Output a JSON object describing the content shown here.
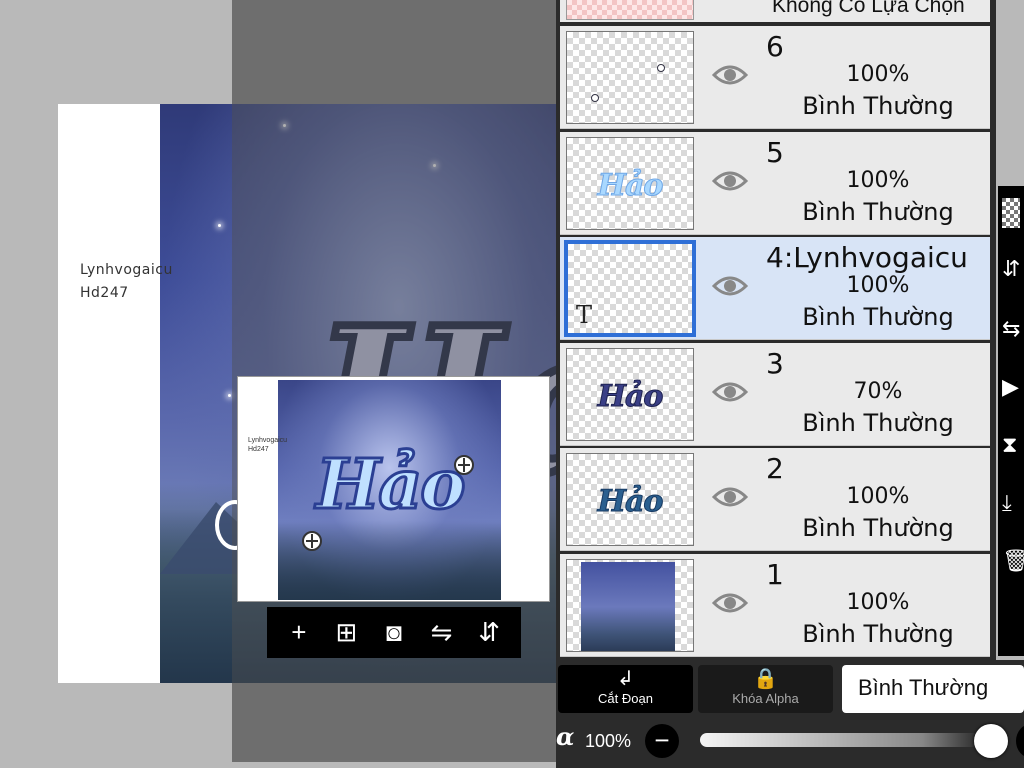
{
  "canvas": {
    "text_line1": "Lynhvogaicu",
    "text_line2": "Hd247",
    "big_letters": "Hả"
  },
  "preview": {
    "title": "Hảo",
    "text_line1": "Lynhvogaicu",
    "text_line2": "Hd247",
    "toolbar_icons": [
      "add-layer-icon",
      "add-image-layer-icon",
      "camera-icon",
      "flip-horizontal-icon",
      "flip-vertical-icon"
    ],
    "toolbar_glyphs": [
      "+",
      "⊞",
      "◙",
      "⇋",
      "⇵"
    ]
  },
  "layers_panel": {
    "top_label": "Không Có Lựa Chọn",
    "layers": [
      {
        "name": "6",
        "opacity": "100%",
        "mode": "Bình Thường",
        "thumb": "stickers"
      },
      {
        "name": "5",
        "opacity": "100%",
        "mode": "Bình Thường",
        "thumb": "word-light",
        "thumb_text": "Hảo"
      },
      {
        "name": "4:Lynhvogaicu",
        "opacity": "100%",
        "mode": "Bình Thường",
        "thumb": "text",
        "thumb_text": "T",
        "selected": true
      },
      {
        "name": "3",
        "opacity": "70%",
        "mode": "Bình Thường",
        "thumb": "word-dark",
        "thumb_text": "Hảo"
      },
      {
        "name": "2",
        "opacity": "100%",
        "mode": "Bình Thường",
        "thumb": "word-teal",
        "thumb_text": "Hảo"
      },
      {
        "name": "1",
        "opacity": "100%",
        "mode": "Bình Thường",
        "thumb": "image"
      }
    ]
  },
  "bottom_bar": {
    "clip_label": "Cắt Đoạn",
    "alpha_lock_label": "Khóa Alpha",
    "blend_mode": "Bình Thường",
    "alpha_symbol": "α",
    "opacity_value": "100%",
    "minus_label": "−",
    "opacity_fraction": 1.0
  },
  "colors": {
    "selected_border": "#2f6fd6",
    "selected_bg": "#d8e4f6",
    "panel_bg": "#2b2b2b"
  }
}
